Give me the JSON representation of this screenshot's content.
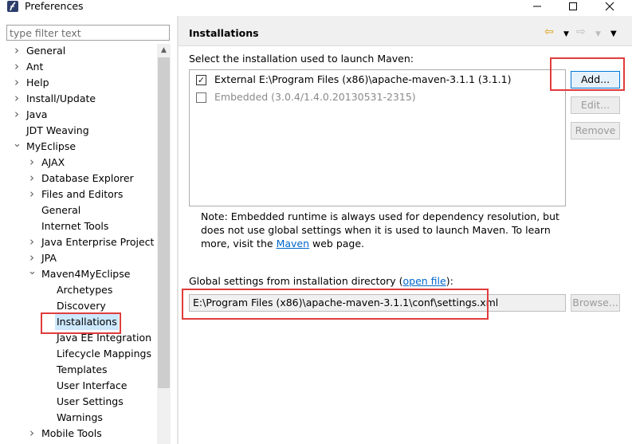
{
  "window": {
    "title": "Preferences"
  },
  "filter": {
    "placeholder": "type filter text"
  },
  "tree": [
    {
      "label": "General",
      "arrow": "›"
    },
    {
      "label": "Ant",
      "arrow": "›"
    },
    {
      "label": "Help",
      "arrow": "›"
    },
    {
      "label": "Install/Update",
      "arrow": "›"
    },
    {
      "label": "Java",
      "arrow": "›"
    },
    {
      "label": "JDT Weaving",
      "arrow": ""
    },
    {
      "label": "MyEclipse",
      "arrow": "⌄"
    },
    {
      "label": "AJAX",
      "arrow": "›"
    },
    {
      "label": "Database Explorer",
      "arrow": "›"
    },
    {
      "label": "Files and Editors",
      "arrow": "›"
    },
    {
      "label": "General",
      "arrow": ""
    },
    {
      "label": "Internet Tools",
      "arrow": ""
    },
    {
      "label": "Java Enterprise Project",
      "arrow": "›"
    },
    {
      "label": "JPA",
      "arrow": "›"
    },
    {
      "label": "Maven4MyEclipse",
      "arrow": "⌄"
    },
    {
      "label": "Archetypes",
      "arrow": ""
    },
    {
      "label": "Discovery",
      "arrow": ""
    },
    {
      "label": "Installations",
      "arrow": ""
    },
    {
      "label": "Java EE Integration",
      "arrow": ""
    },
    {
      "label": "Lifecycle Mappings",
      "arrow": ""
    },
    {
      "label": "Templates",
      "arrow": ""
    },
    {
      "label": "User Interface",
      "arrow": ""
    },
    {
      "label": "User Settings",
      "arrow": ""
    },
    {
      "label": "Warnings",
      "arrow": ""
    },
    {
      "label": "Mobile Tools",
      "arrow": "›"
    }
  ],
  "page": {
    "title": "Installations",
    "select_label": "Select the installation used to launch Maven:",
    "installations": [
      {
        "label": "External E:\\Program Files (x86)\\apache-maven-3.1.1 (3.1.1)",
        "checked": true
      },
      {
        "label": "Embedded (3.0.4/1.4.0.20130531-2315)",
        "checked": false
      }
    ],
    "buttons": {
      "add": "Add...",
      "edit": "Edit...",
      "remove": "Remove",
      "browse": "Browse..."
    },
    "note_text": "Note: Embedded runtime is always used for dependency resolution, but does not use global settings when it is used to launch Maven. To learn more, visit the",
    "note_link": "Maven",
    "note_suffix": "web page.",
    "global_prefix": "Global settings from installation directory (",
    "global_link": "open file",
    "global_suffix": "):",
    "settings_path": "E:\\Program Files (x86)\\apache-maven-3.1.1\\conf\\settings.xml"
  },
  "colors": {
    "highlight": "#e03c3c",
    "link": "#0066cc",
    "selection": "#cce8ff"
  }
}
